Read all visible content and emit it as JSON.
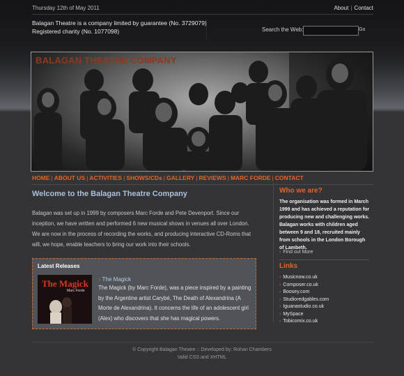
{
  "header": {
    "date": "Thursday 12th of May 2011",
    "top_links": [
      "About",
      "Contact"
    ],
    "company_line1": "Balagan Theatre is a company limited by guarantee (No. 3729079)",
    "company_line2": "Registered charity (No. 1077098)",
    "search_label": "Search the Web:",
    "search_value": "",
    "go_label": "Go"
  },
  "banner": {
    "title": "BALAGAN THEATRE COMPANY"
  },
  "nav": [
    "HOME",
    "ABOUT US",
    "ACTIVITIES",
    "SHOWS/CDs",
    "GALLERY",
    "REVIEWS",
    "MARC FORDE",
    "CONTACT"
  ],
  "main": {
    "heading": "Welcome to the Balagan Theatre Company",
    "intro": "Balagan was set up in 1999 by composers Marc Forde and Pete Devenport. Since our inception, we have written and performed 6 new musical shows in venues all over London. We are now in the process of recording the works, and producing interactive CD-Roms that will, we hope, enable teachers to bring our work into their schools.",
    "releases": {
      "title": "Latest Releases",
      "image_title": "The Magick",
      "image_subtitle": "Marc Forde",
      "link": "The Magick",
      "text": "The Magick (by Marc Forde), was a piece inspired by a painting by the Argentine artist Carybé, The Death of Alexandrina (A Morte de Alexandrina). It concerns the life of an adolescent girl (Alex) who discovers that she has magical powers."
    }
  },
  "sidebar": {
    "who_heading": "Who we are?",
    "who_text": "The organisation was formed in March 1999 and has achieved a reputation for producing new and challenging works. Balagan works with children aged between 9 and 18, recruited mainly from schools in the London Borough of Lambeth.",
    "find_more": "Find out More",
    "links_heading": "Links",
    "links": [
      "Musicnow.co.uk",
      "Composer.co.uk",
      "Boosey.com",
      "Studioredgables.com",
      "Iguanastudio.co.uk",
      "MySpace",
      "Tobicomix.co.uk"
    ]
  },
  "footer": {
    "line1": "© Copyright Balagan Theatre :: Developed by: Rohan Chambers",
    "line2": "Valid CSS and XHTML"
  },
  "colors": {
    "accent": "#e0652b",
    "heading_blue": "#a9c1d9",
    "background": "#343436",
    "banner_title": "#8c3a1e"
  }
}
